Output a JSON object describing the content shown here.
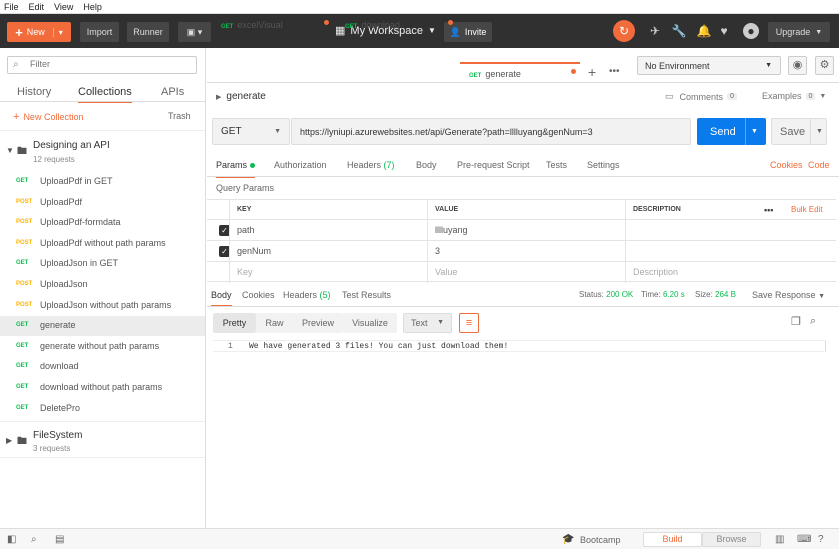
{
  "menu": [
    "File",
    "Edit",
    "View",
    "Help"
  ],
  "toolbar": {
    "new_label": "New",
    "import_label": "Import",
    "runner_label": "Runner",
    "workspace_label": "My Workspace",
    "invite_label": "Invite",
    "upgrade_label": "Upgrade"
  },
  "sidebar": {
    "filter_placeholder": "Filter",
    "tabs": [
      "History",
      "Collections",
      "APIs"
    ],
    "new_collection_label": "New Collection",
    "trash_label": "Trash",
    "collections": [
      {
        "name": "Designing an API",
        "count": "12 requests"
      },
      {
        "name": "FileSystem",
        "count": "3 requests"
      }
    ],
    "requests": [
      {
        "method": "GET",
        "name": "UploadPdf in GET"
      },
      {
        "method": "POST",
        "name": "UploadPdf"
      },
      {
        "method": "POST",
        "name": "UploadPdf-formdata"
      },
      {
        "method": "POST",
        "name": "UploadPdf without path params"
      },
      {
        "method": "GET",
        "name": "UploadJson in GET"
      },
      {
        "method": "POST",
        "name": "UploadJson"
      },
      {
        "method": "POST",
        "name": "UploadJson without path params"
      },
      {
        "method": "GET",
        "name": "generate"
      },
      {
        "method": "GET",
        "name": "generate without path params"
      },
      {
        "method": "GET",
        "name": "download"
      },
      {
        "method": "GET",
        "name": "download without path params"
      },
      {
        "method": "GET",
        "name": "DeletePro"
      }
    ]
  },
  "tabs": [
    {
      "method": "GET",
      "name": "excelVisual"
    },
    {
      "method": "GET",
      "name": "download"
    },
    {
      "method": "GET",
      "name": "generate"
    }
  ],
  "environment": "No Environment",
  "request": {
    "title": "generate",
    "comments_label": "Comments",
    "comments_count": "0",
    "examples_label": "Examples",
    "examples_count": "0",
    "method": "GET",
    "url": "https://lyniupi.azurewebsites.net/api/Generate?path=lllluyang&genNum=3",
    "send_label": "Send",
    "save_label": "Save",
    "tabs": {
      "params": "Params",
      "authorization": "Authorization",
      "headers": "Headers",
      "headers_count": "(7)",
      "body": "Body",
      "prerequest": "Pre-request Script",
      "tests": "Tests",
      "settings": "Settings",
      "cookies": "Cookies",
      "code": "Code"
    },
    "query_params_label": "Query Params",
    "table": {
      "key": "KEY",
      "value": "VALUE",
      "description": "DESCRIPTION",
      "bulk_edit": "Bulk Edit",
      "rows": [
        {
          "key": "path",
          "value": "lllluyang"
        },
        {
          "key": "genNum",
          "value": "3"
        }
      ],
      "placeholder": {
        "key": "Key",
        "value": "Value",
        "description": "Description"
      }
    }
  },
  "response": {
    "tabs": {
      "body": "Body",
      "cookies": "Cookies",
      "headers": "Headers",
      "headers_count": "(5)",
      "test_results": "Test Results"
    },
    "status_label": "Status:",
    "status_value": "200 OK",
    "time_label": "Time:",
    "time_value": "6.20 s",
    "size_label": "Size:",
    "size_value": "264 B",
    "save_response": "Save Response",
    "formats": [
      "Pretty",
      "Raw",
      "Preview",
      "Visualize"
    ],
    "text_type": "Text",
    "line_number": "1",
    "code": "We have generated 3 files! You can just download them!"
  },
  "statusbar": {
    "bootcamp": "Bootcamp",
    "build": "Build",
    "browse": "Browse"
  }
}
